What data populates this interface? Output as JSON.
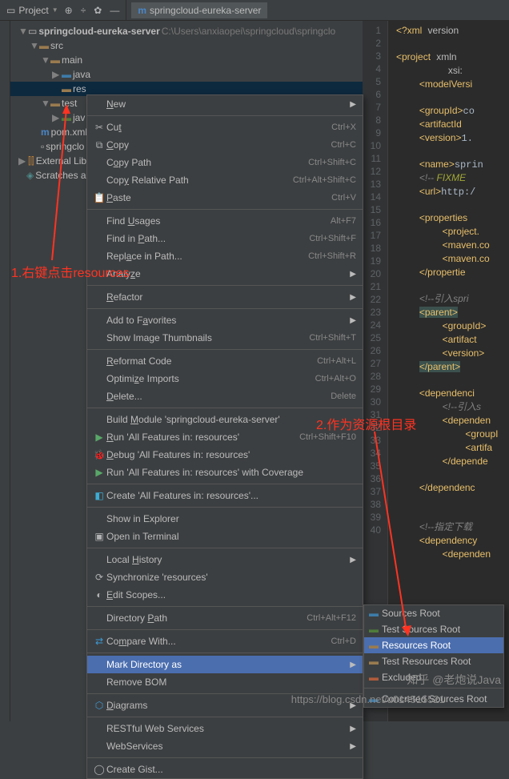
{
  "topbar": {
    "project_label": "Project",
    "editor_tab": "springcloud-eureka-server"
  },
  "tree": {
    "root": "springcloud-eureka-server",
    "root_path": "C:\\Users\\anxiaopei\\springcloud\\springclo",
    "src": "src",
    "main": "main",
    "java": "java",
    "res": "res",
    "test": "test",
    "java2": "jav",
    "pom": "pom.xml",
    "springclo": "springclo",
    "ext": "External Libr",
    "scratch": "Scratches an"
  },
  "menu": {
    "new": "New",
    "cut": "Cut",
    "cut_sc": "Ctrl+X",
    "copy": "Copy",
    "copy_sc": "Ctrl+C",
    "copy_path": "Copy Path",
    "copy_path_sc": "Ctrl+Shift+C",
    "copy_rel": "Copy Relative Path",
    "copy_rel_sc": "Ctrl+Alt+Shift+C",
    "paste": "Paste",
    "paste_sc": "Ctrl+V",
    "find_usages": "Find Usages",
    "find_usages_sc": "Alt+F7",
    "find_path": "Find in Path...",
    "find_path_sc": "Ctrl+Shift+F",
    "replace_path": "Replace in Path...",
    "replace_path_sc": "Ctrl+Shift+R",
    "analyze": "Analyze",
    "refactor": "Refactor",
    "favorites": "Add to Favorites",
    "thumbnails": "Show Image Thumbnails",
    "thumbnails_sc": "Ctrl+Shift+T",
    "reformat": "Reformat Code",
    "reformat_sc": "Ctrl+Alt+L",
    "optimize": "Optimize Imports",
    "optimize_sc": "Ctrl+Alt+O",
    "delete": "Delete...",
    "delete_sc": "Delete",
    "build": "Build Module 'springcloud-eureka-server'",
    "run": "Run 'All Features in: resources'",
    "run_sc": "Ctrl+Shift+F10",
    "debug": "Debug 'All Features in: resources'",
    "coverage": "Run 'All Features in: resources' with Coverage",
    "create": "Create 'All Features in: resources'...",
    "explorer": "Show in Explorer",
    "terminal": "Open in Terminal",
    "history": "Local History",
    "sync": "Synchronize 'resources'",
    "scopes": "Edit Scopes...",
    "dirpath": "Directory Path",
    "dirpath_sc": "Ctrl+Alt+F12",
    "compare": "Compare With...",
    "compare_sc": "Ctrl+D",
    "mark": "Mark Directory as",
    "bom": "Remove BOM",
    "diagrams": "Diagrams",
    "restful": "RESTful Web Services",
    "webservices": "WebServices",
    "gist": "Create Gist..."
  },
  "submenu": {
    "sources": "Sources Root",
    "test_sources": "Test Sources Root",
    "resources": "Resources Root",
    "test_resources": "Test Resources Root",
    "excluded": "Excluded",
    "gen_sources": "Concreted Sources Root"
  },
  "annotations": {
    "a1": "1.右键点击resources",
    "a2": "2.作为资源根目录",
    "watermark1": "知乎 @老炮说Java",
    "watermark2": "https://blog.csdn.net/u014515521"
  },
  "code_lines": [
    "1",
    "2",
    "3",
    "4",
    "5",
    "6",
    "7",
    "8",
    "9",
    "10",
    "11",
    "12",
    "13",
    "14",
    "15",
    "16",
    "17",
    "18",
    "19",
    "20",
    "21",
    "22",
    "23",
    "24",
    "25",
    "26",
    "27",
    "28",
    "29",
    "30",
    "31",
    "32",
    "33",
    "34",
    "35",
    "36",
    "37",
    "38",
    "39",
    "40"
  ]
}
